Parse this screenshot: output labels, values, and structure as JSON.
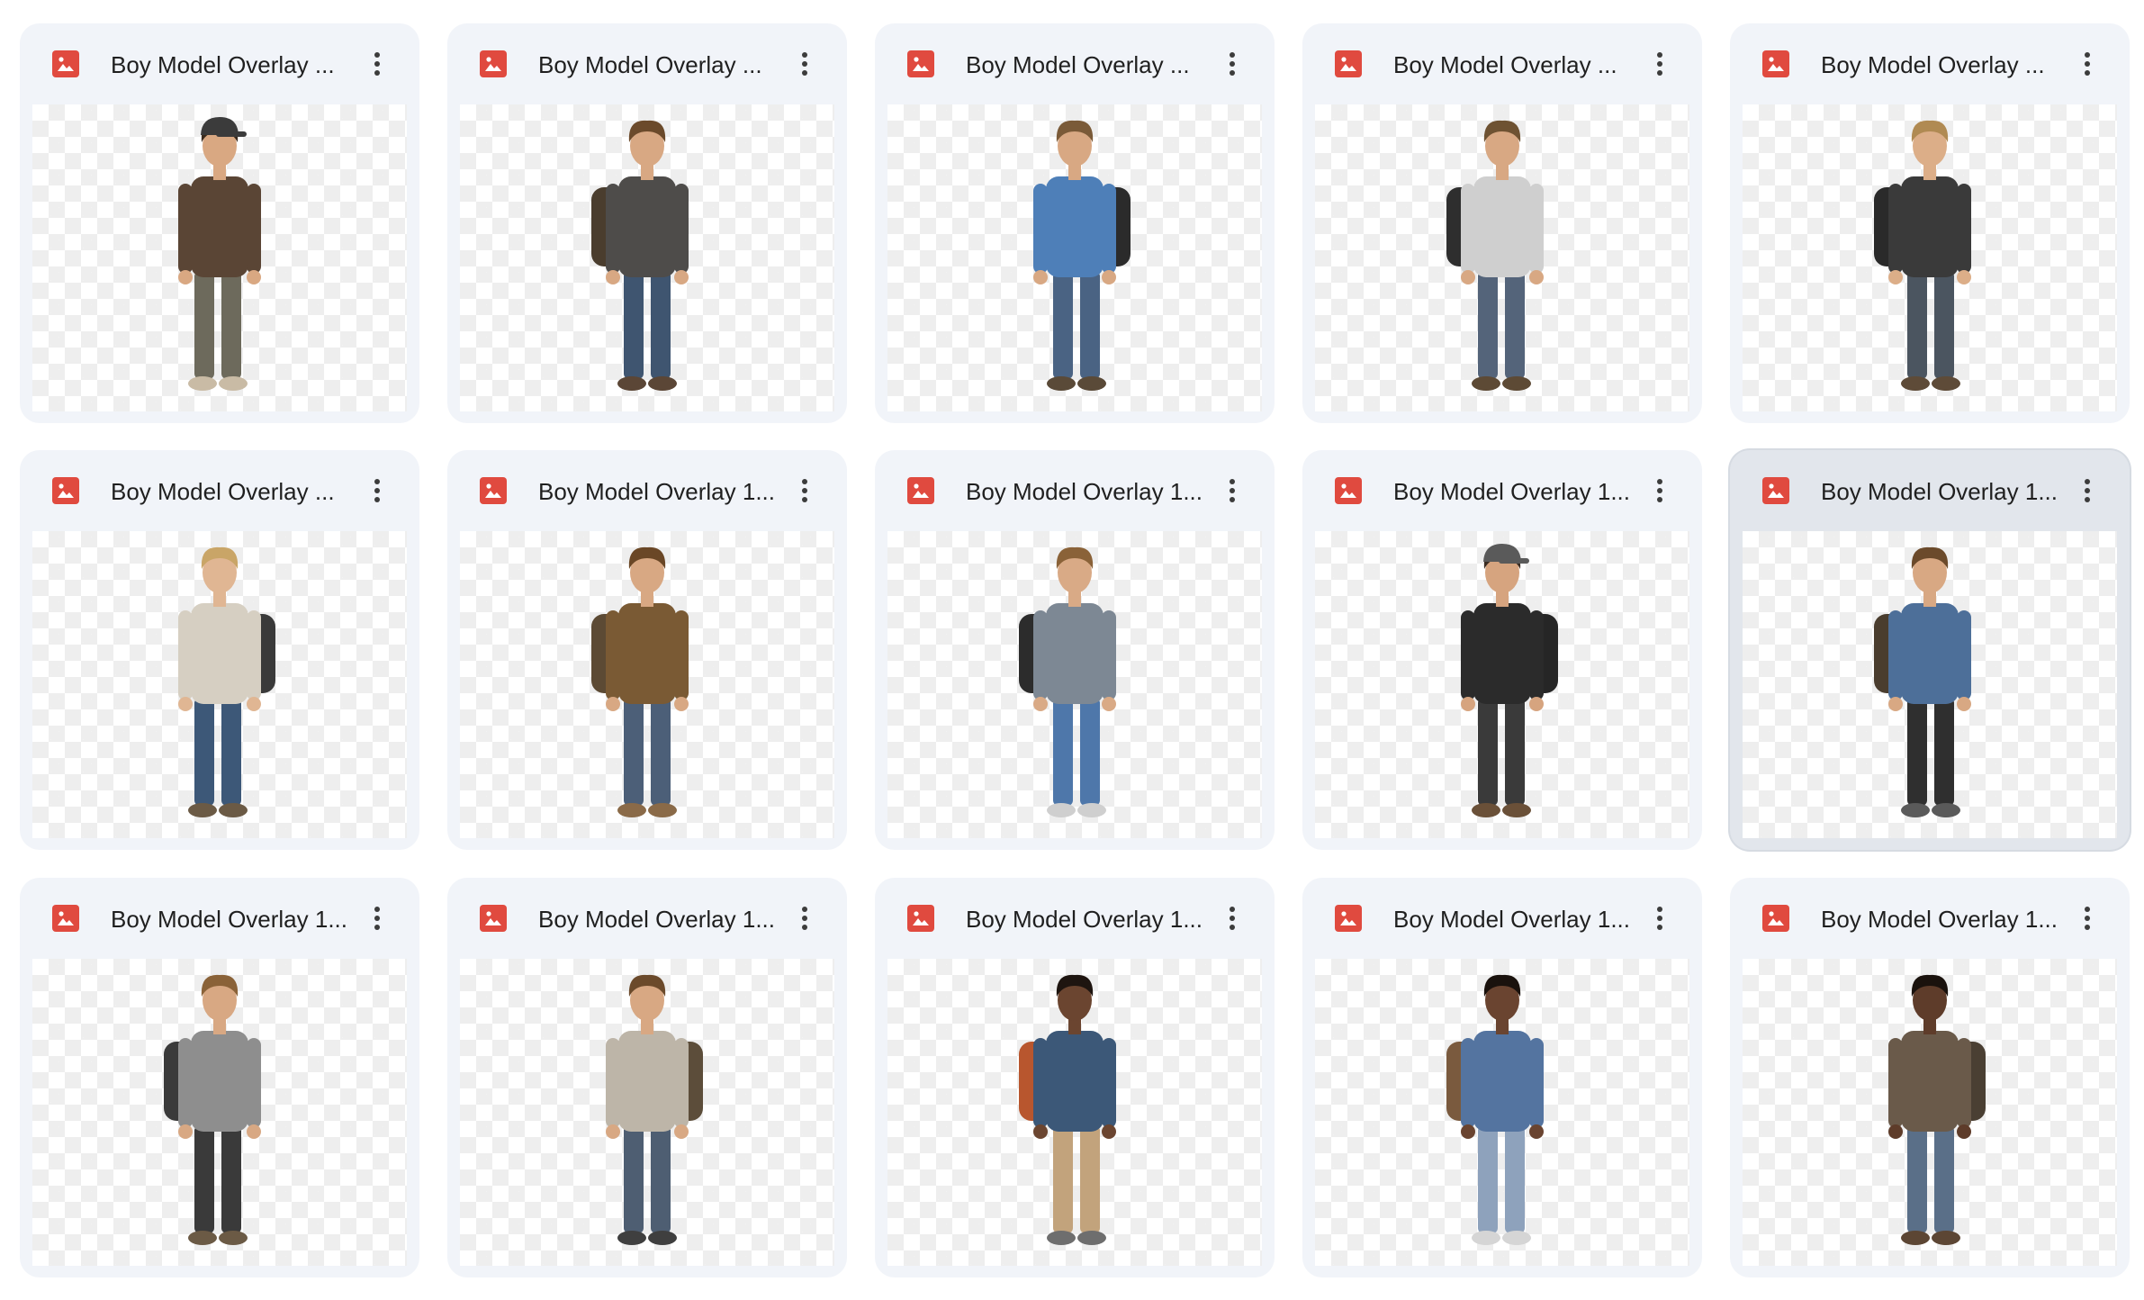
{
  "files": [
    {
      "title": "Boy Model Overlay ...",
      "hair": "#3a2a1c",
      "hat": "#3b3b3b",
      "top": "#5a4535",
      "pants": "#6d6a5c",
      "pack": "",
      "shoes": "#c9bba5",
      "skin": "#d9a882"
    },
    {
      "title": "Boy Model Overlay ...",
      "hair": "#6b4a2b",
      "hat": "",
      "top": "#4e4c4a",
      "pants": "#3f5570",
      "pack": "#4a3d2e",
      "shoes": "#5b4636",
      "skin": "#d8a883"
    },
    {
      "title": "Boy Model Overlay ...",
      "hair": "#7a5a38",
      "hat": "",
      "top": "#4e7fb8",
      "pants": "#4a6383",
      "pack": "#2b2b2b",
      "shoes": "#5a4a38",
      "skin": "#d8a883"
    },
    {
      "title": "Boy Model Overlay ...",
      "hair": "#6e5232",
      "hat": "",
      "top": "#cfcfcf",
      "pants": "#54647a",
      "pack": "#2e2e2e",
      "shoes": "#5d4a35",
      "skin": "#d8a883"
    },
    {
      "title": "Boy Model Overlay ...",
      "hair": "#b08a52",
      "hat": "",
      "top": "#3a3a3a",
      "pants": "#4b5560",
      "pack": "#2a2a2a",
      "shoes": "#5e4b38",
      "skin": "#dcae88"
    },
    {
      "title": "Boy Model Overlay ...",
      "hair": "#c9a567",
      "hat": "",
      "top": "#d6cfc2",
      "pants": "#3d5878",
      "pack": "#3a3a3a",
      "shoes": "#6b5a45",
      "skin": "#e0b693"
    },
    {
      "title": "Boy Model Overlay 1...",
      "hair": "#6a4726",
      "hat": "",
      "top": "#7a5a34",
      "pants": "#4c5f78",
      "pack": "#5c4a34",
      "shoes": "#8a6a48",
      "skin": "#d8a883"
    },
    {
      "title": "Boy Model Overlay 1...",
      "hair": "#8a6238",
      "hat": "",
      "top": "#7d8894",
      "pants": "#4e77aa",
      "pack": "#2c2c2c",
      "shoes": "#cfcfcf",
      "skin": "#d9aa86"
    },
    {
      "title": "Boy Model Overlay 1...",
      "hair": "#3a2c22",
      "hat": "#5a5a5a",
      "top": "#2b2b2b",
      "pants": "#3a3a3a",
      "pack": "#262626",
      "shoes": "#6a5038",
      "skin": "#d6a47f"
    },
    {
      "title": "Boy Model Overlay 1...",
      "hair": "#6b4a2b",
      "hat": "",
      "top": "#4d6f99",
      "pants": "#2f2f2f",
      "pack": "#4a3d2e",
      "shoes": "#5a5a5a",
      "skin": "#d8a883"
    },
    {
      "title": "Boy Model Overlay 1...",
      "hair": "#8a6238",
      "hat": "",
      "top": "#8e8e8e",
      "pants": "#3a3a3a",
      "pack": "#3a3a3a",
      "shoes": "#6b5a45",
      "skin": "#d8a883"
    },
    {
      "title": "Boy Model Overlay 1...",
      "hair": "#6b4a2b",
      "hat": "",
      "top": "#bdb5a8",
      "pants": "#4e5e72",
      "pack": "#5c4d3a",
      "shoes": "#3f3f3f",
      "skin": "#d8a883"
    },
    {
      "title": "Boy Model Overlay 1...",
      "hair": "#1e1510",
      "hat": "",
      "top": "#3c5878",
      "pants": "#c2a37c",
      "pack": "#b8562e",
      "shoes": "#6e6e6e",
      "skin": "#6b4530"
    },
    {
      "title": "Boy Model Overlay 1...",
      "hair": "#1a120d",
      "hat": "",
      "top": "#5474a0",
      "pants": "#8ea2bc",
      "pack": "#7a5a3e",
      "shoes": "#d5d5d5",
      "skin": "#6a4430"
    },
    {
      "title": "Boy Model Overlay 1...",
      "hair": "#1a120d",
      "hat": "",
      "top": "#6a5a4a",
      "pants": "#5a6f88",
      "pack": "#4a3f33",
      "shoes": "#5c4634",
      "skin": "#5e3c2a"
    }
  ],
  "selected_index": 9,
  "icons": {
    "file": "image-file-icon",
    "more": "more-vert-icon"
  }
}
